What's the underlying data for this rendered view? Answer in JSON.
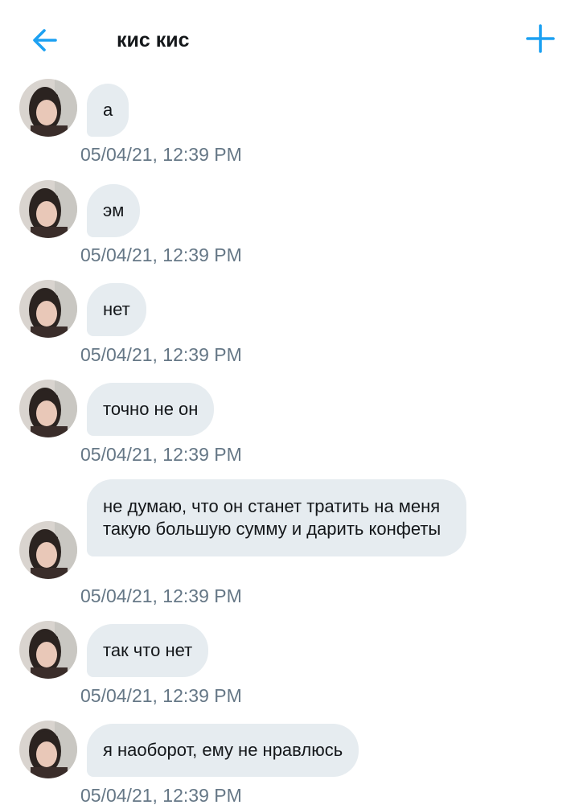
{
  "header": {
    "title": "кис кис"
  },
  "messages": [
    {
      "text": "а",
      "timestamp": "05/04/21, 12:39 PM"
    },
    {
      "text": "эм",
      "timestamp": "05/04/21, 12:39 PM"
    },
    {
      "text": "нет",
      "timestamp": "05/04/21, 12:39 PM"
    },
    {
      "text": "точно не он",
      "timestamp": "05/04/21, 12:39 PM"
    },
    {
      "text": "не думаю, что он станет тратить на меня такую большую сумму и дарить конфеты",
      "timestamp": "05/04/21, 12:39 PM"
    },
    {
      "text": "так что нет",
      "timestamp": "05/04/21, 12:39 PM"
    },
    {
      "text": "я наоборот, ему не нравлюсь",
      "timestamp": "05/04/21, 12:39 PM"
    }
  ],
  "icons": {
    "back": "arrow-left-icon",
    "add": "plus-icon"
  },
  "colors": {
    "accent": "#1da1f2",
    "bubble": "#e6ecf0",
    "timestamp": "#657786",
    "text": "#14171a"
  }
}
